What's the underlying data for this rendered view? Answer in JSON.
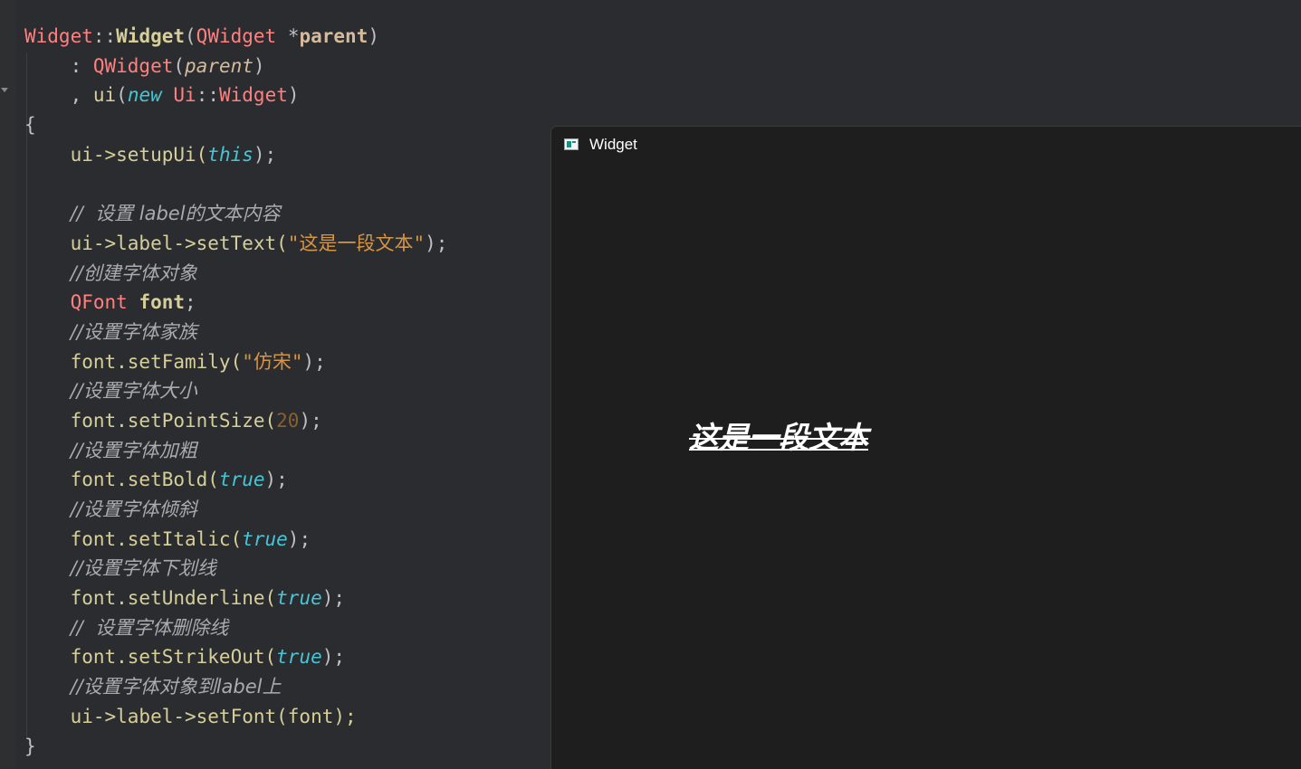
{
  "editor": {
    "lines": [
      [
        {
          "t": "Widget",
          "c": "type"
        },
        {
          "t": "::",
          "c": "p"
        },
        {
          "t": "Widget",
          "c": "fnwb"
        },
        {
          "t": "(",
          "c": "p"
        },
        {
          "t": "QWidget",
          "c": "type"
        },
        {
          "t": " *",
          "c": "p"
        },
        {
          "t": "parent",
          "c": "paramb"
        },
        {
          "t": ")",
          "c": "p"
        }
      ],
      [
        {
          "t": "    : ",
          "c": "p"
        },
        {
          "t": "QWidget",
          "c": "type"
        },
        {
          "t": "(",
          "c": "p"
        },
        {
          "t": "parent",
          "c": "param"
        },
        {
          "t": ")",
          "c": "p"
        }
      ],
      [
        {
          "t": "    , ",
          "c": "p"
        },
        {
          "t": "ui",
          "c": "var"
        },
        {
          "t": "(",
          "c": "p"
        },
        {
          "t": "new",
          "c": "kw"
        },
        {
          "t": " ",
          "c": "p"
        },
        {
          "t": "Ui",
          "c": "type"
        },
        {
          "t": "::",
          "c": "p"
        },
        {
          "t": "Widget",
          "c": "type"
        },
        {
          "t": ")",
          "c": "p"
        }
      ],
      [
        {
          "t": "{",
          "c": "p"
        }
      ],
      [
        {
          "t": "    ui->setupUi(",
          "c": "var"
        },
        {
          "t": "this",
          "c": "kw"
        },
        {
          "t": ");",
          "c": "p"
        }
      ],
      [
        {
          "t": "",
          "c": "p"
        }
      ],
      [
        {
          "t": "    ",
          "c": "p"
        },
        {
          "t": "//  设置 label的文本内容",
          "c": "comment"
        }
      ],
      [
        {
          "t": "    ui->label->setText(",
          "c": "var"
        },
        {
          "t": "\"这是一段文本\"",
          "c": "str"
        },
        {
          "t": ");",
          "c": "p"
        }
      ],
      [
        {
          "t": "    ",
          "c": "p"
        },
        {
          "t": "//创建字体对象",
          "c": "comment"
        }
      ],
      [
        {
          "t": "    ",
          "c": "p"
        },
        {
          "t": "QFont",
          "c": "type"
        },
        {
          "t": " ",
          "c": "p"
        },
        {
          "t": "font",
          "c": "fnwb"
        },
        {
          "t": ";",
          "c": "p"
        }
      ],
      [
        {
          "t": "    ",
          "c": "p"
        },
        {
          "t": "//设置字体家族",
          "c": "comment"
        }
      ],
      [
        {
          "t": "    font.setFamily(",
          "c": "var"
        },
        {
          "t": "\"仿宋\"",
          "c": "str"
        },
        {
          "t": ");",
          "c": "p"
        }
      ],
      [
        {
          "t": "    ",
          "c": "p"
        },
        {
          "t": "//设置字体大小",
          "c": "comment"
        }
      ],
      [
        {
          "t": "    font.setPointSize(",
          "c": "var"
        },
        {
          "t": "20",
          "c": "num"
        },
        {
          "t": ");",
          "c": "p"
        }
      ],
      [
        {
          "t": "    ",
          "c": "p"
        },
        {
          "t": "//设置字体加粗",
          "c": "comment"
        }
      ],
      [
        {
          "t": "    font.setBold(",
          "c": "var"
        },
        {
          "t": "true",
          "c": "kw"
        },
        {
          "t": ");",
          "c": "p"
        }
      ],
      [
        {
          "t": "    ",
          "c": "p"
        },
        {
          "t": "//设置字体倾斜",
          "c": "comment"
        }
      ],
      [
        {
          "t": "    font.setItalic(",
          "c": "var"
        },
        {
          "t": "true",
          "c": "kw"
        },
        {
          "t": ");",
          "c": "p"
        }
      ],
      [
        {
          "t": "    ",
          "c": "p"
        },
        {
          "t": "//设置字体下划线",
          "c": "comment"
        }
      ],
      [
        {
          "t": "    font.setUnderline(",
          "c": "var"
        },
        {
          "t": "true",
          "c": "kw"
        },
        {
          "t": ");",
          "c": "p"
        }
      ],
      [
        {
          "t": "    ",
          "c": "p"
        },
        {
          "t": "//  设置字体删除线",
          "c": "comment"
        }
      ],
      [
        {
          "t": "    font.setStrikeOut(",
          "c": "var"
        },
        {
          "t": "true",
          "c": "kw"
        },
        {
          "t": ");",
          "c": "p"
        }
      ],
      [
        {
          "t": "    ",
          "c": "p"
        },
        {
          "t": "//设置字体对象到label上",
          "c": "comment"
        }
      ],
      [
        {
          "t": "    ui->label->setFont(font);",
          "c": "var"
        }
      ],
      [
        {
          "t": "}",
          "c": "p"
        }
      ]
    ]
  },
  "window": {
    "title": "Widget",
    "icon": "qt-window-icon",
    "label_text": "这是一段文本"
  }
}
